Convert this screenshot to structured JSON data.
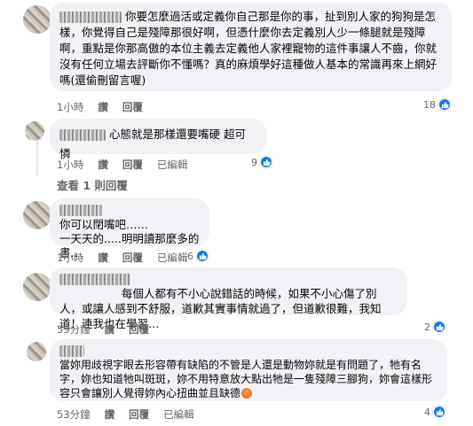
{
  "comments": [
    {
      "text": "你要怎麼過活或定義你自己那是你的事，扯到別人家的狗狗是怎樣，你覺得自己是殘障那很好啊，但憑什麼你去定義別人少一條腿就是殘障啊，重點是你那高傲的本位主義去定義他人家裡寵物的這件事讓人不齒，你就沒有任何立場去評斷你不懂嗎？真的麻煩學好這種做人基本的常識再來上網好嗎(還偷刪留言喔)",
      "time": "1小時",
      "like": "讚",
      "reply": "回覆",
      "edited": "",
      "reactions": "18"
    },
    {
      "text": "心態就是那樣還要嘴硬 超可憐",
      "time": "1小時",
      "like": "讚",
      "reply": "回覆",
      "edited": "已編輯",
      "reactions": "9",
      "view_replies": "查看 1 則回覆"
    },
    {
      "text_line1": "你可以閉嘴吧……",
      "text_line2": "一天天的.....明明讀那麼多的書..",
      "time": "1小時",
      "like": "讚",
      "reply": "回覆",
      "edited": "已編輯",
      "reactions": "6"
    },
    {
      "text": "每個人都有不小心說錯話的時候，如果不小心傷了別人，或讓人感到不舒服，道歉其實事情就過了，但道歉很難，我知道！連我也在學習…",
      "time": "59分鐘",
      "like": "讚",
      "reply": "回覆",
      "edited": "",
      "reactions": "2"
    },
    {
      "text": "當妳用歧視字眼去形容帶有缺陷的不管是人還是動物妳就是有問題了，牠有名字，妳也知道牠叫斑斑，妳不用特意放大點出牠是一隻殘障三腳狗，妳會這樣形容只會讓別人覺得妳內心扭曲並且缺德",
      "time": "53分鐘",
      "like": "讚",
      "reply": "回覆",
      "edited": "已編輯",
      "reactions": "4"
    }
  ],
  "colors": {
    "bubble": "#f0f2f5",
    "like_blue": "#1877f2",
    "meta_gray": "#65676b"
  },
  "icons": {
    "reaction": "like-thumb-icon",
    "angry_emoji": "angry-face-emoji-icon"
  }
}
